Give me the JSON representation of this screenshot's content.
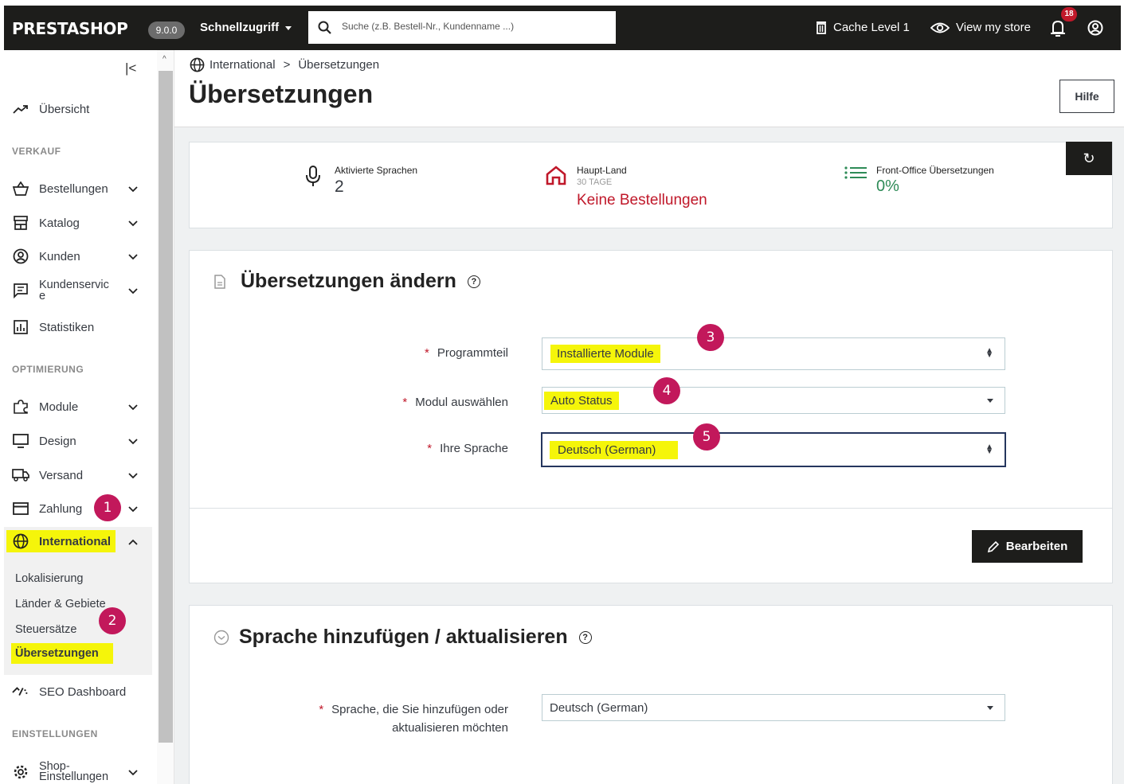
{
  "header": {
    "logo": "PRESTASHOP",
    "version": "9.0.0",
    "quick_access": "Schnellzugriff",
    "search_placeholder": "Suche (z.B. Bestell-Nr., Kundenname ...)",
    "cache": "Cache Level 1",
    "view_store": "View my store",
    "notifications": "18"
  },
  "sidebar": {
    "overview": "Übersicht",
    "section_sales": "VERKAUF",
    "orders": "Bestellungen",
    "catalog": "Katalog",
    "customers": "Kunden",
    "customer_service": "Kundenservic e",
    "statistics": "Statistiken",
    "section_optimization": "OPTIMIERUNG",
    "modules": "Module",
    "design": "Design",
    "shipping": "Versand",
    "payment": "Zahlung",
    "international": "International",
    "sub": [
      "Lokalisierung",
      "Länder & Gebiete",
      "Steuersätze",
      "Übersetzungen"
    ],
    "seo": "SEO Dashboard",
    "section_settings": "EINSTELLUNGEN",
    "shop_settings": "Shop- Einstellungen"
  },
  "annotations": [
    "1",
    "2",
    "3",
    "4",
    "5"
  ],
  "breadcrumb": {
    "parent": "International",
    "separator": ">",
    "current": "Übersetzungen"
  },
  "page_title": "Übersetzungen",
  "help_button": "Hilfe",
  "kpis": {
    "languages_label": "Aktivierte Sprachen",
    "languages_value": "2",
    "country_label": "Haupt-Land",
    "country_sub": "30 TAGE",
    "country_value": "Keine Bestellungen",
    "front_label": "Front-Office Übersetzungen",
    "front_value": "0%"
  },
  "modify": {
    "title": "Übersetzungen ändern",
    "type_label": "Programmteil",
    "type_value": "Installierte Module",
    "module_label": "Modul auswählen",
    "module_value": "Auto Status",
    "language_label": "Ihre Sprache",
    "language_value": "Deutsch (German)",
    "edit_button": "Bearbeiten"
  },
  "add_language": {
    "title": "Sprache hinzufügen / aktualisieren",
    "label_line1": "Sprache, die Sie hinzufügen oder",
    "label_line2": "aktualisieren möchten",
    "value": "Deutsch (German)"
  },
  "colors": {
    "highlight": "#f5f50a",
    "annotation": "#c2185b",
    "danger": "#c0182a",
    "success": "#2e8b57",
    "dark": "#1d1d1b"
  }
}
